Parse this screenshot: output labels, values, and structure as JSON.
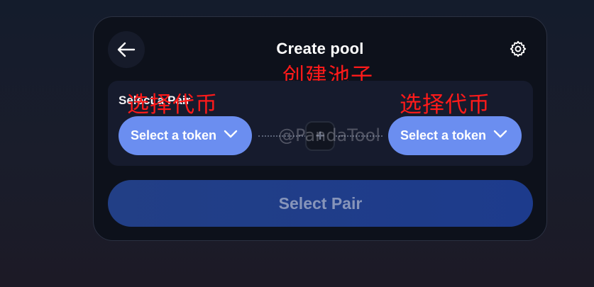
{
  "header": {
    "title": "Create pool",
    "back_icon": "arrow-left-icon",
    "settings_icon": "gear-icon"
  },
  "annotations": {
    "title_cn": "创建池子",
    "token_left_cn": "选择代币",
    "token_right_cn": "选择代币",
    "color": "#ff1a1a"
  },
  "pair": {
    "label": "Select a Pair",
    "token_a": "Select a token",
    "token_b": "Select a token",
    "plus": "+",
    "watermark": "@PandaTool"
  },
  "action": {
    "label": "Select Pair"
  },
  "colors": {
    "token_button": "#6b8ef0",
    "primary_button": "#1d3b8c",
    "card": "#0d111b"
  }
}
